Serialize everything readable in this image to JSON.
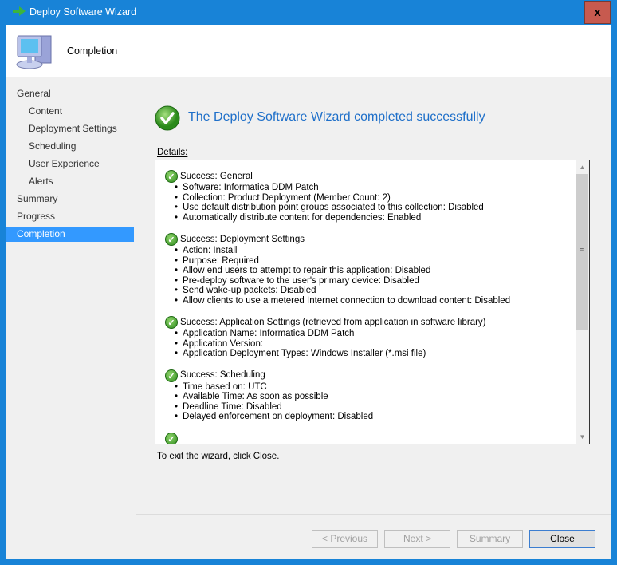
{
  "window": {
    "title": "Deploy Software Wizard",
    "close_label": "x"
  },
  "header": {
    "title": "Completion"
  },
  "sidebar": {
    "items": [
      {
        "label": "General"
      },
      {
        "label": "Content"
      },
      {
        "label": "Deployment Settings"
      },
      {
        "label": "Scheduling"
      },
      {
        "label": "User Experience"
      },
      {
        "label": "Alerts"
      },
      {
        "label": "Summary"
      },
      {
        "label": "Progress"
      },
      {
        "label": "Completion"
      }
    ],
    "selected": "Completion"
  },
  "main": {
    "heading": "The Deploy Software Wizard completed successfully",
    "details_label": "Details:",
    "sections": [
      {
        "title": "Success: General",
        "items": [
          "Software: Informatica DDM Patch",
          "Collection: Product Deployment (Member Count: 2)",
          "Use default distribution point groups associated to this collection: Disabled",
          "Automatically distribute content for dependencies: Enabled"
        ]
      },
      {
        "title": "Success: Deployment Settings",
        "items": [
          "Action: Install",
          "Purpose: Required",
          "Allow end users to attempt to repair this application: Disabled",
          "Pre-deploy software to the user's primary device: Disabled",
          "Send wake-up packets: Disabled",
          "Allow clients to use a metered Internet connection to download content: Disabled"
        ]
      },
      {
        "title": "Success: Application Settings (retrieved from application in software library)",
        "items": [
          "Application Name: Informatica DDM Patch",
          "Application Version:",
          "Application Deployment Types: Windows Installer (*.msi file)"
        ]
      },
      {
        "title": "Success: Scheduling",
        "items": [
          "Time based on: UTC",
          "Available Time: As soon as possible",
          "Deadline Time: Disabled",
          "Delayed enforcement on deployment: Disabled"
        ]
      }
    ],
    "exit_text": "To exit the wizard, click Close."
  },
  "buttons": {
    "previous": "< Previous",
    "next": "Next >",
    "summary": "Summary",
    "close": "Close"
  },
  "colors": {
    "accent": "#1883d7",
    "heading": "#1e6fc9",
    "selection": "#3399ff",
    "close_button": "#c75a4f"
  }
}
